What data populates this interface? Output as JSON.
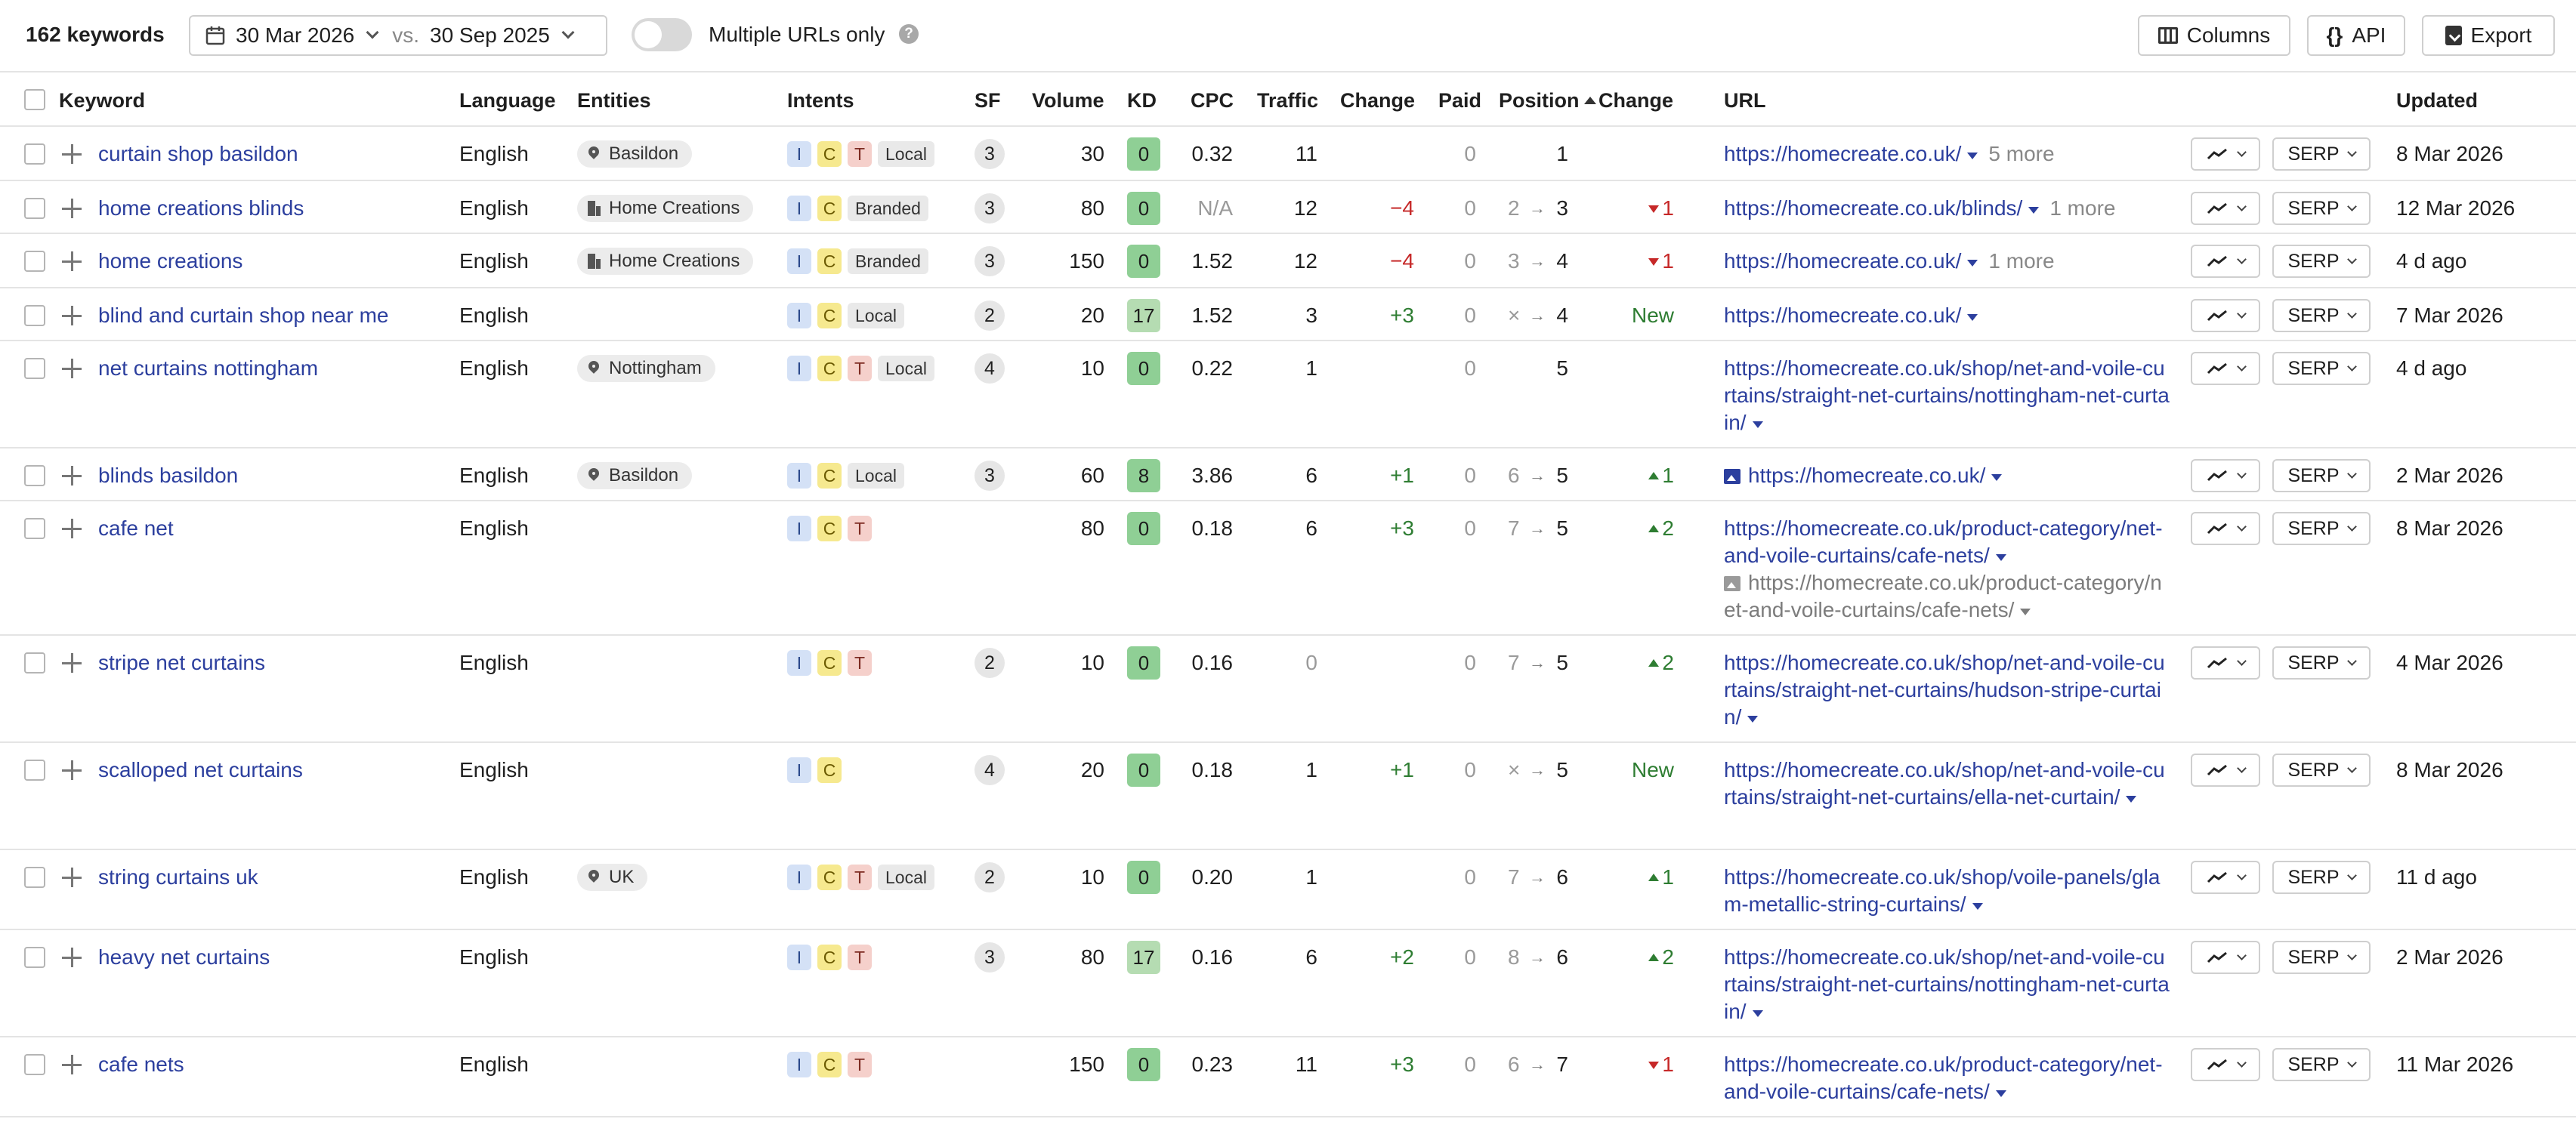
{
  "toolbar": {
    "count": "162 keywords",
    "date_from": "30 Mar 2026",
    "vs": "vs.",
    "date_to": "30 Sep 2025",
    "multiple_urls": "Multiple URLs only",
    "help": "?",
    "columns": "Columns",
    "api_braces": "{}",
    "api": "API",
    "export": "Export"
  },
  "headers": {
    "keyword": "Keyword",
    "language": "Language",
    "entities": "Entities",
    "intents": "Intents",
    "sf": "SF",
    "volume": "Volume",
    "kd": "KD",
    "cpc": "CPC",
    "traffic": "Traffic",
    "change": "Change",
    "paid": "Paid",
    "position": "Position",
    "pos_change": "Change",
    "url": "URL",
    "updated": "Updated"
  },
  "serp_label": "SERP",
  "rows": [
    {
      "keyword": "curtain shop basildon",
      "language": "English",
      "entity": "Basildon",
      "entity_icon": "pin",
      "intents": [
        "I",
        "C",
        "T"
      ],
      "intent_label": "Local",
      "sf": "3",
      "volume": "30",
      "kd": "0",
      "kd_color": "#8fcf95",
      "cpc": "0.32",
      "traffic": "11",
      "change": "",
      "paid": "0",
      "pos_from": "",
      "pos_arrow": "",
      "pos_to": "1",
      "pos_change": "",
      "pos_dir": "",
      "url": "https://homecreate.co.uk/",
      "more": "5 more",
      "url2": "",
      "updated": "8 Mar 2026"
    },
    {
      "keyword": "home creations blinds",
      "language": "English",
      "entity": "Home Creations",
      "entity_icon": "building",
      "intents": [
        "I",
        "C"
      ],
      "intent_label": "Branded",
      "sf": "3",
      "volume": "80",
      "kd": "0",
      "kd_color": "#8fcf95",
      "cpc": "N/A",
      "traffic": "12",
      "change": "−4",
      "paid": "0",
      "pos_from": "2",
      "pos_arrow": "→",
      "pos_to": "3",
      "pos_change": "1",
      "pos_dir": "down",
      "url": "https://homecreate.co.uk/blinds/",
      "more": "1 more",
      "url2": "",
      "updated": "12 Mar 2026"
    },
    {
      "keyword": "home creations",
      "language": "English",
      "entity": "Home Creations",
      "entity_icon": "building",
      "intents": [
        "I",
        "C"
      ],
      "intent_label": "Branded",
      "sf": "3",
      "volume": "150",
      "kd": "0",
      "kd_color": "#8fcf95",
      "cpc": "1.52",
      "traffic": "12",
      "change": "−4",
      "paid": "0",
      "pos_from": "3",
      "pos_arrow": "→",
      "pos_to": "4",
      "pos_change": "1",
      "pos_dir": "down",
      "url": "https://homecreate.co.uk/",
      "more": "1 more",
      "url2": "",
      "updated": "4 d ago"
    },
    {
      "keyword": "blind and curtain shop near me",
      "language": "English",
      "entity": "",
      "entity_icon": "",
      "intents": [
        "I",
        "C"
      ],
      "intent_label": "Local",
      "sf": "2",
      "volume": "20",
      "kd": "17",
      "kd_color": "#b5dcb2",
      "cpc": "1.52",
      "traffic": "3",
      "change": "+3",
      "paid": "0",
      "pos_from": "×",
      "pos_arrow": "→",
      "pos_to": "4",
      "pos_change": "New",
      "pos_dir": "new",
      "url": "https://homecreate.co.uk/",
      "more": "",
      "url2": "",
      "updated": "7 Mar 2026"
    },
    {
      "keyword": "net curtains nottingham",
      "language": "English",
      "entity": "Nottingham",
      "entity_icon": "pin",
      "intents": [
        "I",
        "C",
        "T"
      ],
      "intent_label": "Local",
      "sf": "4",
      "volume": "10",
      "kd": "0",
      "kd_color": "#8fcf95",
      "cpc": "0.22",
      "traffic": "1",
      "change": "",
      "paid": "0",
      "pos_from": "",
      "pos_arrow": "",
      "pos_to": "5",
      "pos_change": "",
      "pos_dir": "",
      "url": "https://homecreate.co.uk/shop/net-and-voile-curtains/straight-net-curtains/nottingham-net-curtain/",
      "more": "",
      "url2": "",
      "updated": "4 d ago"
    },
    {
      "keyword": "blinds basildon",
      "language": "English",
      "entity": "Basildon",
      "entity_icon": "pin",
      "intents": [
        "I",
        "C"
      ],
      "intent_label": "Local",
      "sf": "3",
      "volume": "60",
      "kd": "8",
      "kd_color": "#8fcf95",
      "cpc": "3.86",
      "traffic": "6",
      "change": "+1",
      "paid": "0",
      "pos_from": "6",
      "pos_arrow": "→",
      "pos_to": "5",
      "pos_change": "1",
      "pos_dir": "up",
      "url": "https://homecreate.co.uk/",
      "more": "",
      "url2": "",
      "url_img": true,
      "updated": "2 Mar 2026"
    },
    {
      "keyword": "cafe net",
      "language": "English",
      "entity": "",
      "entity_icon": "",
      "intents": [
        "I",
        "C",
        "T"
      ],
      "intent_label": "",
      "sf": "",
      "volume": "80",
      "kd": "0",
      "kd_color": "#8fcf95",
      "cpc": "0.18",
      "traffic": "6",
      "change": "+3",
      "paid": "0",
      "pos_from": "7",
      "pos_arrow": "→",
      "pos_to": "5",
      "pos_change": "2",
      "pos_dir": "up",
      "url": "https://homecreate.co.uk/product-category/net-and-voile-curtains/cafe-nets/",
      "more": "",
      "url2": "https://homecreate.co.uk/product-category/net-and-voile-curtains/cafe-nets/",
      "updated": "8 Mar 2026"
    },
    {
      "keyword": "stripe net curtains",
      "language": "English",
      "entity": "",
      "entity_icon": "",
      "intents": [
        "I",
        "C",
        "T"
      ],
      "intent_label": "",
      "sf": "2",
      "volume": "10",
      "kd": "0",
      "kd_color": "#8fcf95",
      "cpc": "0.16",
      "traffic": "0",
      "change": "",
      "paid": "0",
      "pos_from": "7",
      "pos_arrow": "→",
      "pos_to": "5",
      "pos_change": "2",
      "pos_dir": "up",
      "url": "https://homecreate.co.uk/shop/net-and-voile-curtains/straight-net-curtains/hudson-stripe-curtain/",
      "more": "",
      "url2": "",
      "updated": "4 Mar 2026"
    },
    {
      "keyword": "scalloped net curtains",
      "language": "English",
      "entity": "",
      "entity_icon": "",
      "intents": [
        "I",
        "C"
      ],
      "intent_label": "",
      "sf": "4",
      "volume": "20",
      "kd": "0",
      "kd_color": "#8fcf95",
      "cpc": "0.18",
      "traffic": "1",
      "change": "+1",
      "paid": "0",
      "pos_from": "×",
      "pos_arrow": "→",
      "pos_to": "5",
      "pos_change": "New",
      "pos_dir": "new",
      "url": "https://homecreate.co.uk/shop/net-and-voile-curtains/straight-net-curtains/ella-net-curtain/",
      "more": "",
      "url2": "",
      "updated": "8 Mar 2026"
    },
    {
      "keyword": "string curtains uk",
      "language": "English",
      "entity": "UK",
      "entity_icon": "pin",
      "intents": [
        "I",
        "C",
        "T"
      ],
      "intent_label": "Local",
      "sf": "2",
      "volume": "10",
      "kd": "0",
      "kd_color": "#8fcf95",
      "cpc": "0.20",
      "traffic": "1",
      "change": "",
      "paid": "0",
      "pos_from": "7",
      "pos_arrow": "→",
      "pos_to": "6",
      "pos_change": "1",
      "pos_dir": "up",
      "url": "https://homecreate.co.uk/shop/voile-panels/glam-metallic-string-curtains/",
      "more": "",
      "url2": "",
      "updated": "11 d ago"
    },
    {
      "keyword": "heavy net curtains",
      "language": "English",
      "entity": "",
      "entity_icon": "",
      "intents": [
        "I",
        "C",
        "T"
      ],
      "intent_label": "",
      "sf": "3",
      "volume": "80",
      "kd": "17",
      "kd_color": "#b5dcb2",
      "cpc": "0.16",
      "traffic": "6",
      "change": "+2",
      "paid": "0",
      "pos_from": "8",
      "pos_arrow": "→",
      "pos_to": "6",
      "pos_change": "2",
      "pos_dir": "up",
      "url": "https://homecreate.co.uk/shop/net-and-voile-curtains/straight-net-curtains/nottingham-net-curtain/",
      "more": "",
      "url2": "",
      "updated": "2 Mar 2026"
    },
    {
      "keyword": "cafe nets",
      "language": "English",
      "entity": "",
      "entity_icon": "",
      "intents": [
        "I",
        "C",
        "T"
      ],
      "intent_label": "",
      "sf": "",
      "volume": "150",
      "kd": "0",
      "kd_color": "#8fcf95",
      "cpc": "0.23",
      "traffic": "11",
      "change": "+3",
      "paid": "0",
      "pos_from": "6",
      "pos_arrow": "→",
      "pos_to": "7",
      "pos_change": "1",
      "pos_dir": "down",
      "url": "https://homecreate.co.uk/product-category/net-and-voile-curtains/cafe-nets/",
      "more": "",
      "url2": "",
      "updated": "11 Mar 2026"
    }
  ]
}
